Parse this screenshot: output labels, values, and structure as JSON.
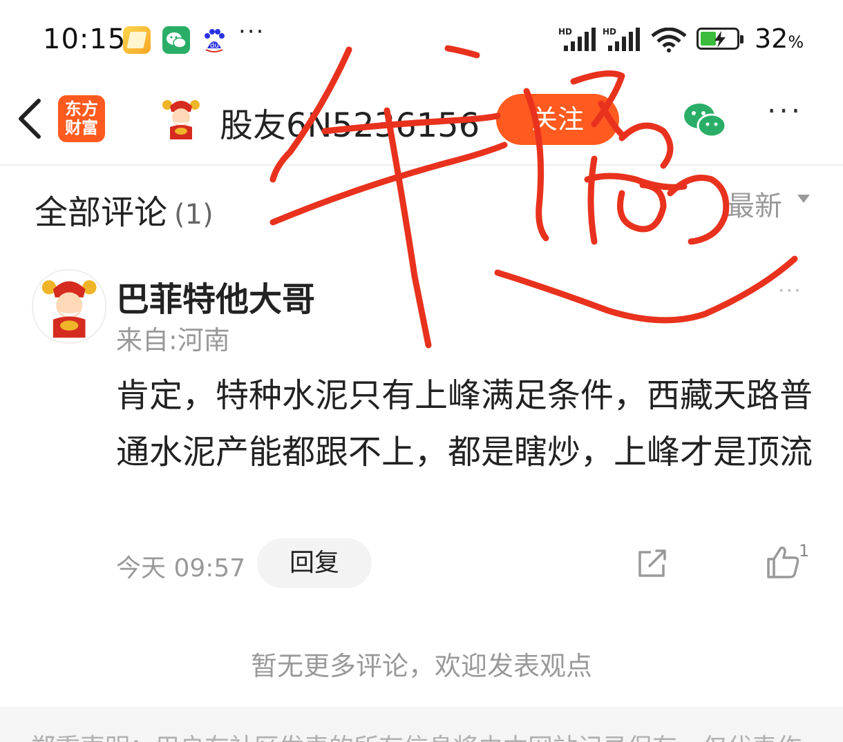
{
  "status_bar": {
    "time": "10:15",
    "battery_percent": "32",
    "battery_unit": "%",
    "network_label_1": "HD",
    "network_label_2": "HD",
    "notification_icons": [
      "notes-app-icon",
      "wechat-icon",
      "baidu-icon"
    ],
    "more_dots": "···"
  },
  "header": {
    "brand_line1": "东方",
    "brand_line2": "财富",
    "username": "股友6N5236156",
    "follow_label": "关注",
    "menu": "···"
  },
  "comments": {
    "title": "全部评论",
    "count": "(1)",
    "sort_label": "最新"
  },
  "comment": {
    "author": "巴菲特他大哥",
    "location": "来自:河南",
    "more": "···",
    "body": "肯定，特种水泥只有上峰满足条件，西藏天路普通水泥产能都跟不上，都是瞎炒，上峰才是顶流",
    "time": "今天 09:57",
    "reply_label": "回复",
    "like_count": "1"
  },
  "no_more_text": "暂无更多评论，欢迎发表观点",
  "footer_text": "郑重声明：用户在社区发表的所有信息将由本网站记录保存，仅代表作",
  "colors": {
    "accent": "#ff5a1f",
    "scribble": "#e8321e",
    "muted_text": "#999999"
  }
}
